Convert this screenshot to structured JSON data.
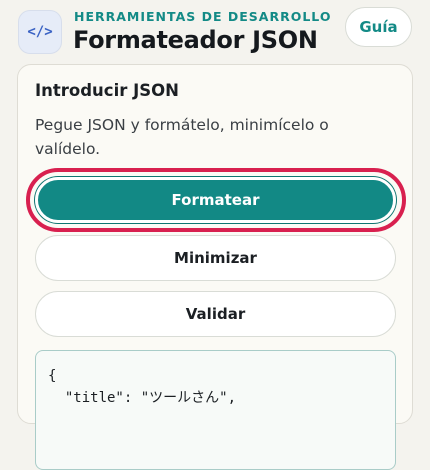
{
  "header": {
    "icon": "code-icon",
    "icon_glyph": "</>",
    "kicker": "HERRAMIENTAS DE DESARROLLO",
    "title": "Formateador JSON",
    "guide_label": "Guía"
  },
  "card": {
    "title": "Introducir JSON",
    "description": "Pegue JSON y formátelo, minimícelo o valídelo.",
    "format_label": "Formatear",
    "minify_label": "Minimizar",
    "validate_label": "Validar",
    "editor_value": "{\n  \"title\": \"ツールさん\","
  },
  "colors": {
    "accent": "#128985",
    "focus_ring": "#d8204f",
    "background": "#f4f3ee"
  }
}
